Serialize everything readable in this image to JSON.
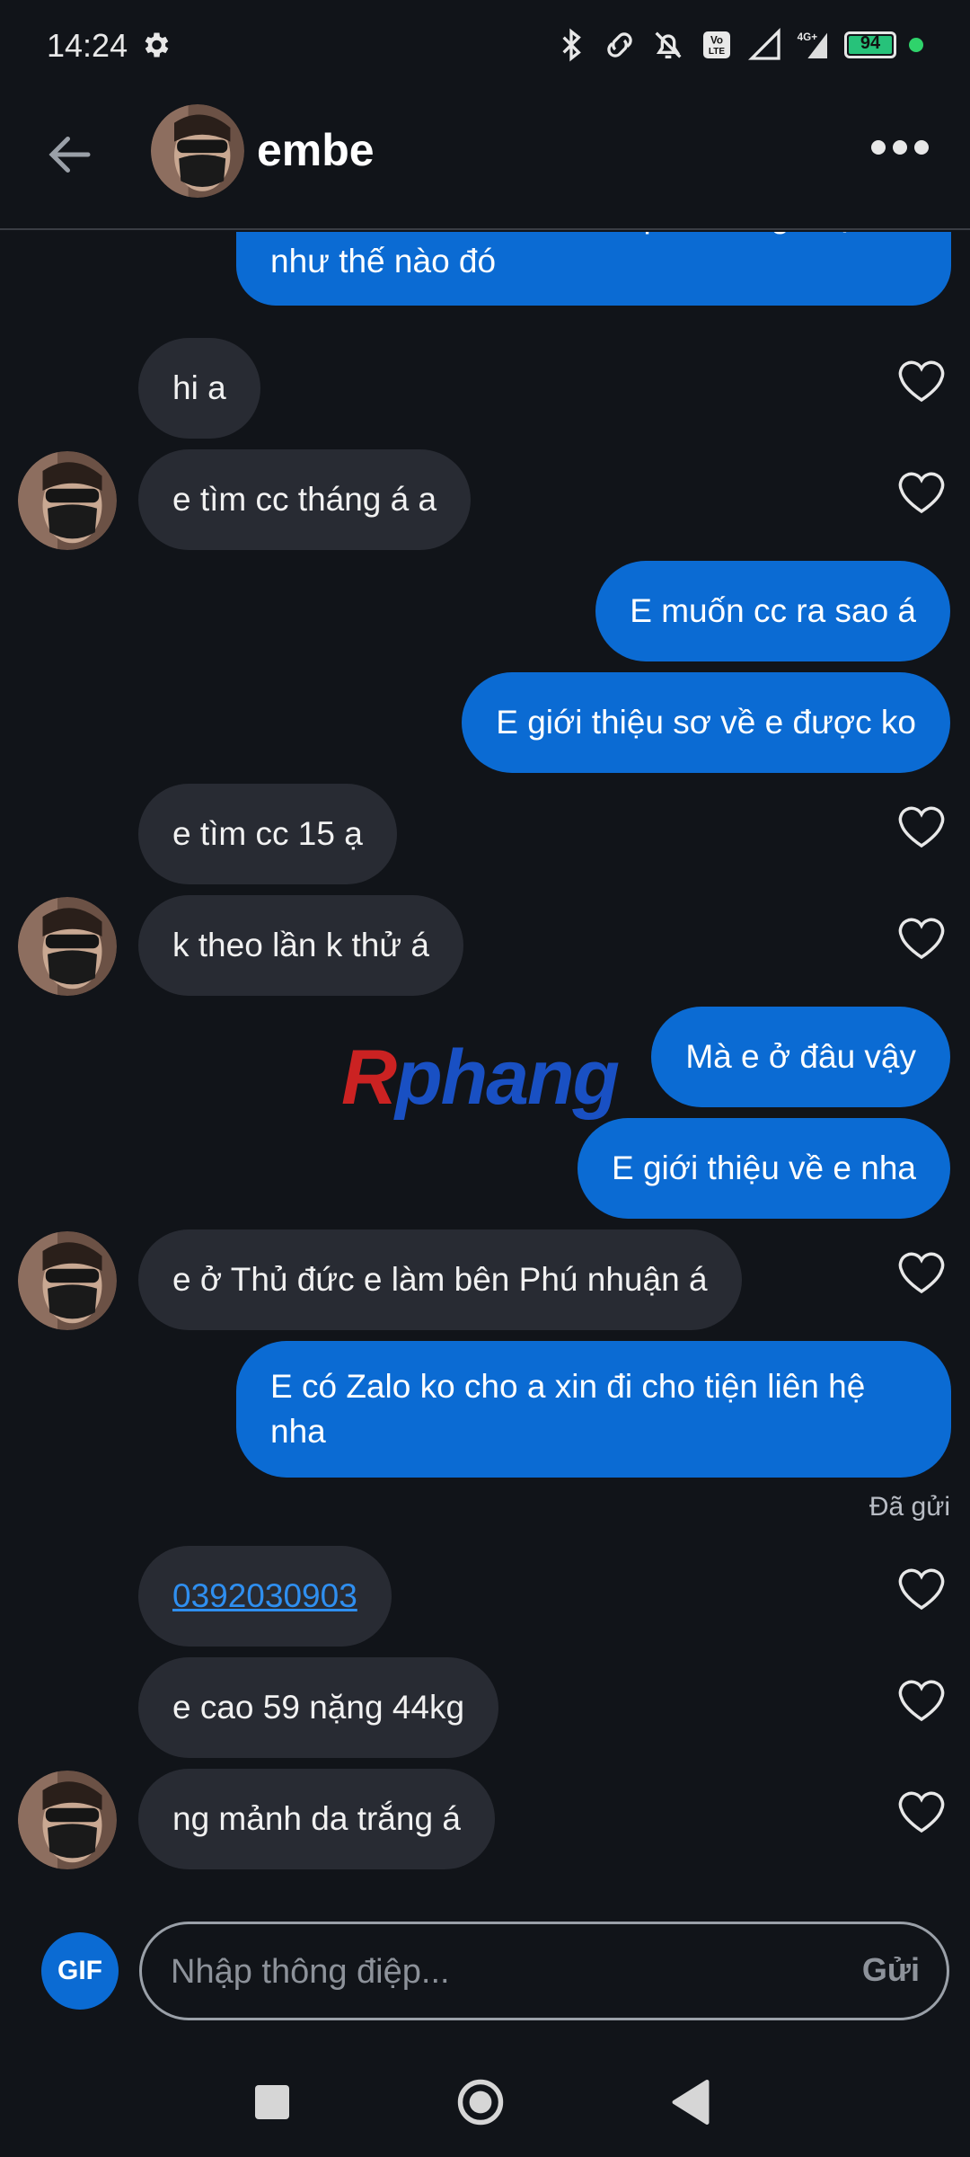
{
  "status_bar": {
    "time": "14:24",
    "battery": "94",
    "icons": [
      "gear-icon",
      "bluetooth-icon",
      "link-icon",
      "bell-off-icon",
      "volte-icon",
      "signal-icon",
      "signal-4g-icon",
      "battery-icon",
      "green-dot"
    ]
  },
  "header": {
    "contact_name": "embe"
  },
  "messages": [
    {
      "id": "m0",
      "side": "out",
      "text": "Ko biết e bé muốn tìm mqh ko ràng buộc như thế nào đó"
    },
    {
      "id": "m1",
      "side": "in",
      "text": "hi a"
    },
    {
      "id": "m2",
      "side": "in",
      "text": "e tìm cc tháng á a"
    },
    {
      "id": "m3",
      "side": "out",
      "text": "E muốn cc ra sao á"
    },
    {
      "id": "m4",
      "side": "out",
      "text": "E giới thiệu sơ về e được ko"
    },
    {
      "id": "m5",
      "side": "in",
      "text": "e tìm cc 15 ạ"
    },
    {
      "id": "m6",
      "side": "in",
      "text": "k theo lần k thử á"
    },
    {
      "id": "m7",
      "side": "out",
      "text": "Mà e ở đâu vậy"
    },
    {
      "id": "m8",
      "side": "out",
      "text": "E giới thiệu về e nha"
    },
    {
      "id": "m9",
      "side": "in",
      "text": "e ở Thủ đức e làm bên Phú nhuận á"
    },
    {
      "id": "m10",
      "side": "out",
      "text": "E có Zalo ko cho a xin đi cho tiện liên hệ nha"
    },
    {
      "id": "m11",
      "side": "in",
      "text": "0392030903"
    },
    {
      "id": "m12",
      "side": "in",
      "text": "e cao 59 nặng 44kg"
    },
    {
      "id": "m13",
      "side": "in",
      "text": "ng mảnh da trắng á"
    }
  ],
  "sent_status": "Đã gửi",
  "watermark": {
    "r": "R",
    "rest": "phang"
  },
  "composer": {
    "gif_label": "GIF",
    "placeholder": "Nhập thông điệp...",
    "send_label": "Gửi"
  },
  "colors": {
    "background": "#111419",
    "incoming_bubble": "#282b33",
    "outgoing_bubble": "#0b6bd3",
    "link": "#2f8ff0"
  }
}
